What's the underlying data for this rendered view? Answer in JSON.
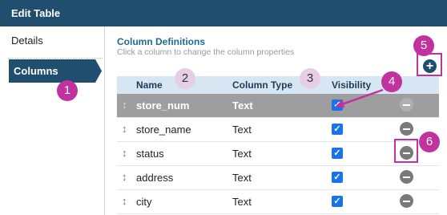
{
  "window": {
    "title": "Edit Table"
  },
  "sidebar": {
    "items": [
      {
        "label": "Details"
      },
      {
        "label": "Columns",
        "active": true
      }
    ]
  },
  "main": {
    "title": "Column Definitions",
    "subtitle": "Click a column to change the column properties"
  },
  "table": {
    "headers": {
      "name": "Name",
      "type": "Column Type",
      "visibility": "Visibility"
    },
    "rows": [
      {
        "name": "store_num",
        "type": "Text",
        "visible": true,
        "selected": true
      },
      {
        "name": "store_name",
        "type": "Text",
        "visible": true
      },
      {
        "name": "status",
        "type": "Text",
        "visible": true
      },
      {
        "name": "address",
        "type": "Text",
        "visible": true
      },
      {
        "name": "city",
        "type": "Text",
        "visible": true
      }
    ]
  },
  "callouts": [
    "1",
    "2",
    "3",
    "4",
    "5",
    "6"
  ],
  "icons": {
    "add": "plus-circle-icon",
    "remove": "minus-circle-icon",
    "drag": "drag-handle-icon",
    "check": "checkbox-icon"
  },
  "colors": {
    "header": "#1f4e6e",
    "accent": "#c2329e",
    "selected_row": "#9e9e9e",
    "table_header": "#d6e7f3",
    "checkbox": "#1a73e8"
  }
}
